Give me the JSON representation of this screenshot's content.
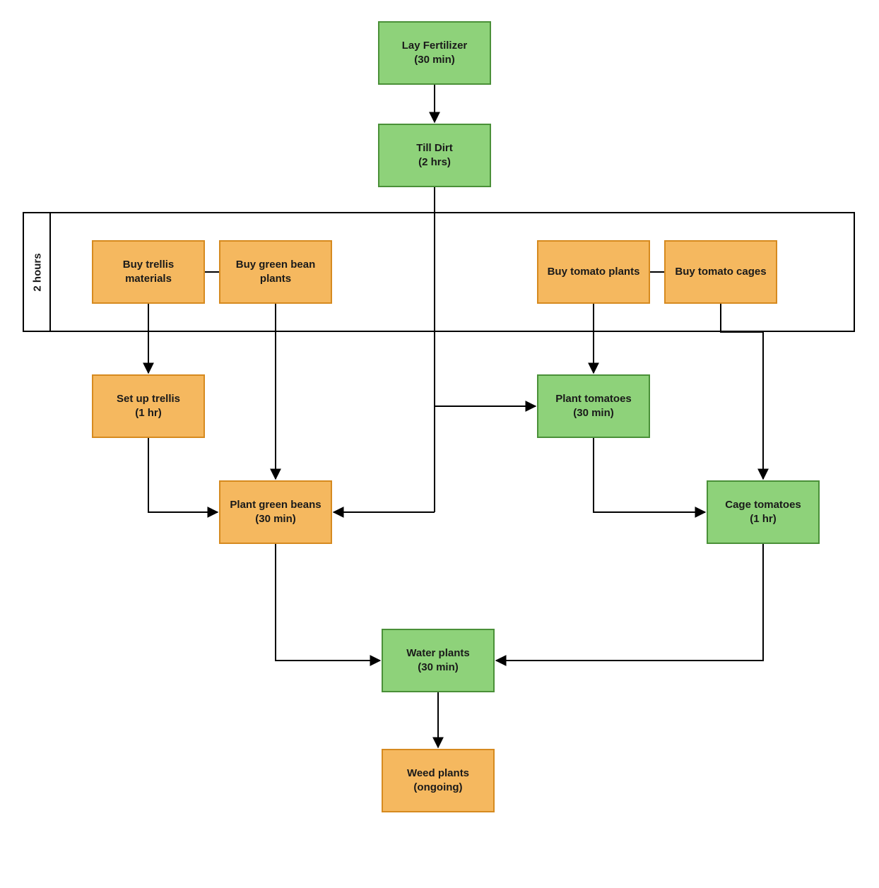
{
  "group": {
    "label": "2 hours"
  },
  "nodes": {
    "lay_fertilizer": {
      "title": "Lay Fertilizer",
      "duration": "(30 min)"
    },
    "till_dirt": {
      "title": "Till Dirt",
      "duration": "(2 hrs)"
    },
    "buy_trellis": {
      "title": "Buy trellis materials",
      "duration": ""
    },
    "buy_green_beans": {
      "title": "Buy green bean plants",
      "duration": ""
    },
    "buy_tomato_plants": {
      "title": "Buy tomato plants",
      "duration": ""
    },
    "buy_tomato_cages": {
      "title": "Buy tomato cages",
      "duration": ""
    },
    "setup_trellis": {
      "title": "Set up trellis",
      "duration": "(1 hr)"
    },
    "plant_tomatoes": {
      "title": "Plant tomatoes",
      "duration": "(30 min)"
    },
    "plant_green_beans": {
      "title": "Plant green beans",
      "duration": "(30 min)"
    },
    "cage_tomatoes": {
      "title": "Cage tomatoes",
      "duration": "(1 hr)"
    },
    "water_plants": {
      "title": "Water plants",
      "duration": "(30 min)"
    },
    "weed_plants": {
      "title": "Weed plants",
      "duration": "(ongoing)"
    }
  },
  "chart_data": {
    "type": "flowchart",
    "group": {
      "label": "2 hours",
      "members": [
        "buy_trellis",
        "buy_green_beans",
        "buy_tomato_plants",
        "buy_tomato_cages"
      ]
    },
    "nodes": [
      {
        "id": "lay_fertilizer",
        "label": "Lay Fertilizer",
        "duration": "30 min",
        "color": "green"
      },
      {
        "id": "till_dirt",
        "label": "Till Dirt",
        "duration": "2 hrs",
        "color": "green"
      },
      {
        "id": "buy_trellis",
        "label": "Buy trellis materials",
        "duration": "",
        "color": "orange"
      },
      {
        "id": "buy_green_beans",
        "label": "Buy green bean plants",
        "duration": "",
        "color": "orange"
      },
      {
        "id": "buy_tomato_plants",
        "label": "Buy tomato plants",
        "duration": "",
        "color": "orange"
      },
      {
        "id": "buy_tomato_cages",
        "label": "Buy tomato cages",
        "duration": "",
        "color": "orange"
      },
      {
        "id": "setup_trellis",
        "label": "Set up trellis",
        "duration": "1 hr",
        "color": "orange"
      },
      {
        "id": "plant_tomatoes",
        "label": "Plant tomatoes",
        "duration": "30 min",
        "color": "green"
      },
      {
        "id": "plant_green_beans",
        "label": "Plant green beans",
        "duration": "30 min",
        "color": "orange"
      },
      {
        "id": "cage_tomatoes",
        "label": "Cage tomatoes",
        "duration": "1 hr",
        "color": "green"
      },
      {
        "id": "water_plants",
        "label": "Water plants",
        "duration": "30 min",
        "color": "green"
      },
      {
        "id": "weed_plants",
        "label": "Weed plants",
        "duration": "ongoing",
        "color": "orange"
      }
    ],
    "edges": [
      {
        "from": "lay_fertilizer",
        "to": "till_dirt"
      },
      {
        "from": "till_dirt",
        "to": "plant_tomatoes"
      },
      {
        "from": "till_dirt",
        "to": "plant_green_beans"
      },
      {
        "from": "buy_trellis",
        "to": "buy_green_beans",
        "undirected": true
      },
      {
        "from": "buy_tomato_plants",
        "to": "buy_tomato_cages",
        "undirected": true
      },
      {
        "from": "buy_trellis",
        "to": "setup_trellis"
      },
      {
        "from": "buy_green_beans",
        "to": "plant_green_beans"
      },
      {
        "from": "buy_tomato_plants",
        "to": "plant_tomatoes"
      },
      {
        "from": "buy_tomato_cages",
        "to": "cage_tomatoes"
      },
      {
        "from": "setup_trellis",
        "to": "plant_green_beans"
      },
      {
        "from": "plant_tomatoes",
        "to": "cage_tomatoes"
      },
      {
        "from": "plant_green_beans",
        "to": "water_plants"
      },
      {
        "from": "cage_tomatoes",
        "to": "water_plants"
      },
      {
        "from": "water_plants",
        "to": "weed_plants"
      }
    ]
  }
}
